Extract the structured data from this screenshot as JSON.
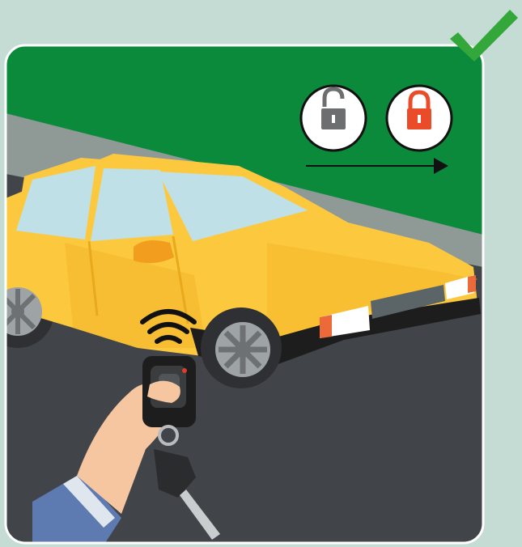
{
  "scene": {
    "description_icon_names": [
      "unlocked-padlock-icon",
      "locked-padlock-icon",
      "arrow-right-icon",
      "check-mark-icon",
      "wireless-signal-icon",
      "car-key-fob-icon"
    ],
    "colors": {
      "page_background": "#c5dcd5",
      "sky_green": "#0a8a3a",
      "sidewalk_gray": "#8f9a97",
      "road_asphalt": "#414549",
      "car_yellow": "#fcc93e",
      "car_yellow_shadow": "#e9a91d",
      "window_blue": "#bfe0e6",
      "check_green": "#34a73a",
      "lock_gray": "#6d6e70",
      "lock_red": "#ea4b28",
      "sleeve_blue": "#5d7bb1",
      "skin": "#f6c6a0"
    },
    "state": {
      "from": "unlocked",
      "to": "locked",
      "correct": true
    }
  }
}
